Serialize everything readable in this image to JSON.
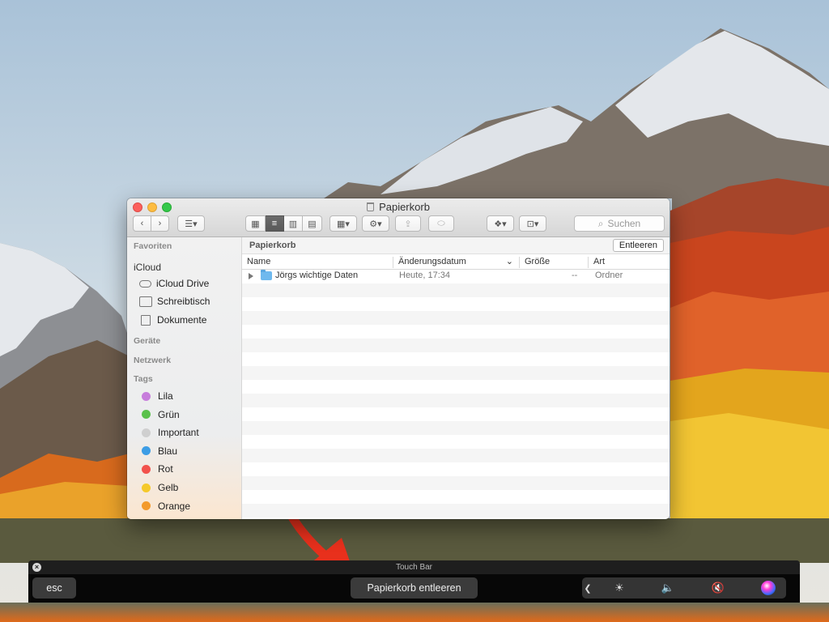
{
  "finder": {
    "title": "Papierkorb",
    "search_placeholder": "Suchen",
    "path_title": "Papierkorb",
    "empty_button": "Entleeren",
    "sidebar": {
      "favorites": "Favoriten",
      "icloud": "iCloud",
      "icloud_items": [
        {
          "label": "iCloud Drive",
          "icon": "cloud-icon"
        },
        {
          "label": "Schreibtisch",
          "icon": "desktop-icon"
        },
        {
          "label": "Dokumente",
          "icon": "document-icon"
        }
      ],
      "devices": "Geräte",
      "network": "Netzwerk",
      "tags_header": "Tags",
      "tags": [
        {
          "label": "Lila",
          "color": "#c77ddc"
        },
        {
          "label": "Grün",
          "color": "#5ac14b"
        },
        {
          "label": "Important",
          "color": "#cfcfcf"
        },
        {
          "label": "Blau",
          "color": "#3d9de5"
        },
        {
          "label": "Rot",
          "color": "#f2524c"
        },
        {
          "label": "Gelb",
          "color": "#f5c92a"
        },
        {
          "label": "Orange",
          "color": "#f39a2b"
        }
      ]
    },
    "columns": {
      "name": "Name",
      "date": "Änderungsdatum",
      "size": "Größe",
      "kind": "Art"
    },
    "rows": [
      {
        "name": "Jörgs wichtige Daten",
        "date": "Heute, 17:34",
        "size": "--",
        "kind": "Ordner"
      }
    ]
  },
  "touchbar": {
    "label": "Touch Bar",
    "esc": "esc",
    "action": "Papierkorb entleeren",
    "collapse": "❮"
  },
  "colors": {
    "arrow": "#e8301c"
  }
}
